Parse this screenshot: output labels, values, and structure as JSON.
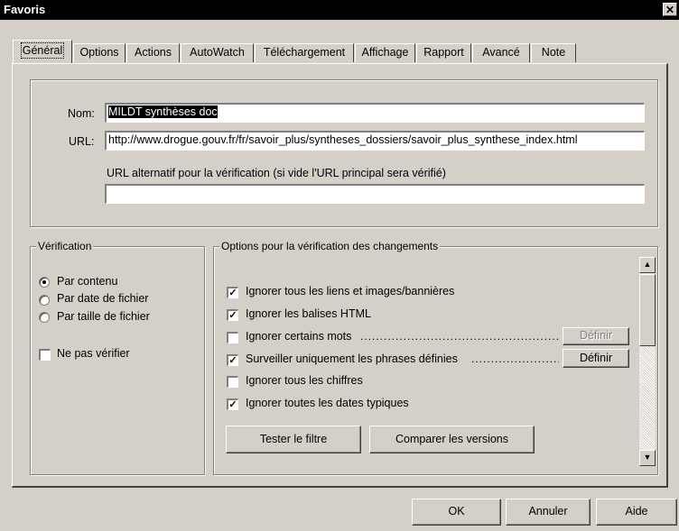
{
  "window": {
    "title": "Favoris",
    "close_glyph": "✕"
  },
  "tabs": [
    "Général",
    "Options",
    "Actions",
    "AutoWatch",
    "Téléchargement",
    "Affichage",
    "Rapport",
    "Avancé",
    "Note"
  ],
  "form": {
    "name_label": "Nom:",
    "name_value": "MILDT synthèses doc",
    "url_label": "URL:",
    "url_value": "http://www.drogue.gouv.fr/fr/savoir_plus/syntheses_dossiers/savoir_plus_synthese_index.html",
    "alt_url_label": "URL alternatif pour la vérification (si vide l'URL principal sera vérifié)",
    "alt_url_value": ""
  },
  "verification": {
    "title": "Vérification",
    "options": [
      {
        "label": "Par contenu",
        "selected": true
      },
      {
        "label": "Par date de fichier",
        "selected": false
      },
      {
        "label": "Par taille de fichier",
        "selected": false
      }
    ],
    "no_check": {
      "label": "Ne pas vérifier",
      "checked": false
    }
  },
  "change_options": {
    "title": "Options pour la vérification des changements",
    "items": [
      {
        "label": "Ignorer tous les liens et images/bannières",
        "checked": true
      },
      {
        "label": "Ignorer les balises HTML",
        "checked": true
      },
      {
        "label": "Ignorer certains mots",
        "checked": false,
        "button": "Définir",
        "button_enabled": false
      },
      {
        "label": "Surveiller uniquement les phrases définies",
        "checked": true,
        "button": "Définir",
        "button_enabled": true
      },
      {
        "label": "Ignorer tous les chiffres",
        "checked": false
      },
      {
        "label": "Ignorer toutes les dates typiques",
        "checked": true
      }
    ],
    "test_filter_button": "Tester le filtre",
    "compare_button": "Comparer les versions"
  },
  "footer": {
    "ok": "OK",
    "cancel": "Annuler",
    "help": "Aide"
  },
  "icons": {
    "scroll_up": "▲",
    "scroll_down": "▼",
    "check_mark": "✓",
    "close": "close-icon"
  }
}
